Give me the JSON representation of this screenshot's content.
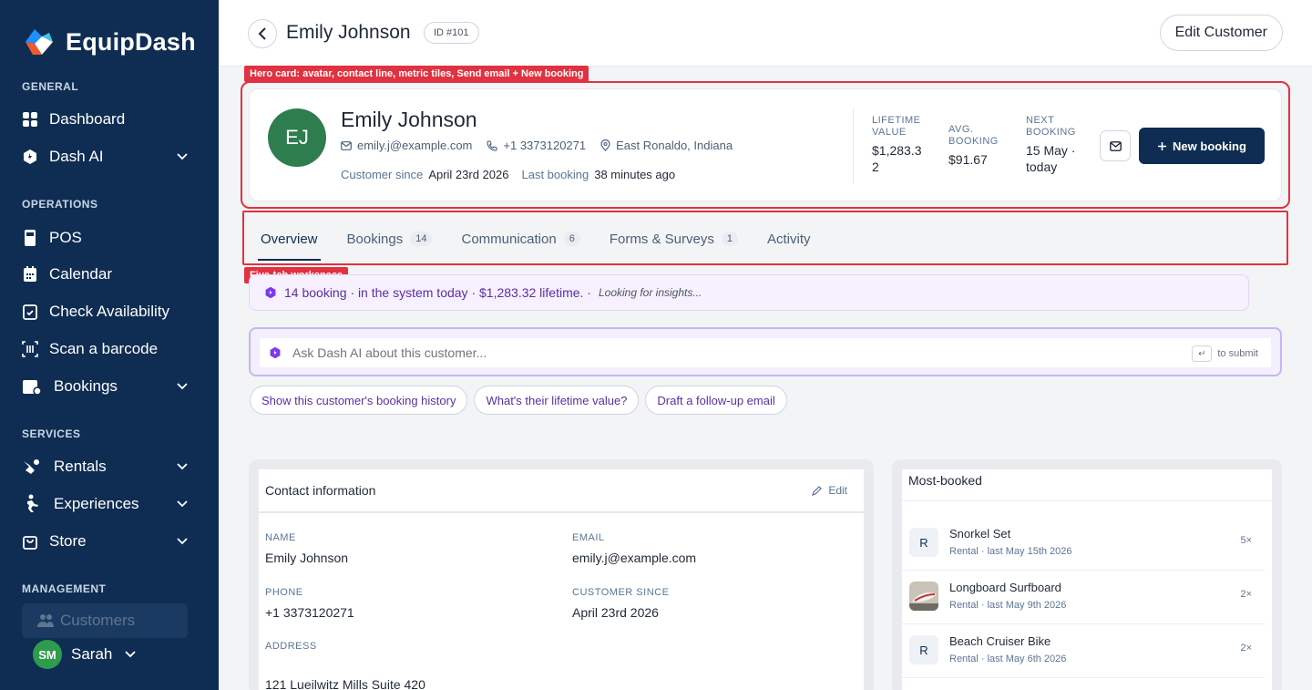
{
  "app": {
    "name": "EquipDash"
  },
  "sidebar": {
    "sections": [
      {
        "label": "GENERAL"
      },
      {
        "label": "OPERATIONS"
      },
      {
        "label": "SERVICES"
      },
      {
        "label": "MANAGEMENT"
      }
    ],
    "items": [
      {
        "label": "Dashboard",
        "icon": "grid-icon"
      },
      {
        "label": "Dash AI",
        "icon": "dash-ai-icon"
      },
      {
        "label": "POS",
        "icon": "pos-icon"
      },
      {
        "label": "Calendar",
        "icon": "calendar-icon"
      },
      {
        "label": "Check Availability",
        "icon": "calendar-check-icon"
      },
      {
        "label": "Scan a barcode",
        "icon": "barcode-icon"
      },
      {
        "label": "Bookings",
        "icon": "bookings-icon"
      },
      {
        "label": "Rentals",
        "icon": "rentals-icon"
      },
      {
        "label": "Experiences",
        "icon": "experiences-icon"
      },
      {
        "label": "Store",
        "icon": "store-icon"
      },
      {
        "label": "Customers",
        "icon": "customers-icon"
      }
    ],
    "user": {
      "initials": "SM",
      "name": "Sarah"
    }
  },
  "topbar": {
    "title": "Emily Johnson",
    "id_badge": "ID #101",
    "edit_label": "Edit Customer"
  },
  "annotations": {
    "hero": "Hero card: avatar, contact line, metric tiles, Send email + New booking",
    "tabs": "Five-tab workspace"
  },
  "hero": {
    "initials": "EJ",
    "name": "Emily Johnson",
    "email": "emily.j@example.com",
    "phone": "+1 3373120271",
    "location": "East Ronaldo, Indiana",
    "since_label": "Customer since",
    "since_value": "April 23rd 2026",
    "last_label": "Last booking",
    "last_value": "38 minutes ago",
    "metrics": [
      {
        "label": "LIFETIME VALUE",
        "value": "$1,283.32"
      },
      {
        "label": "AVG. BOOKING",
        "value": "$91.67"
      },
      {
        "label": "NEXT BOOKING",
        "value": "15 May · today"
      }
    ],
    "new_booking": "New booking"
  },
  "tabs": [
    {
      "label": "Overview",
      "count": ""
    },
    {
      "label": "Bookings",
      "count": "14"
    },
    {
      "label": "Communication",
      "count": "6"
    },
    {
      "label": "Forms & Surveys",
      "count": "1"
    },
    {
      "label": "Activity",
      "count": ""
    }
  ],
  "insight": {
    "text": "14 booking · in the system today · $1,283.32 lifetime. ·",
    "loading": "Looking for insights..."
  },
  "ask": {
    "placeholder": "Ask Dash AI about this customer...",
    "hint": "to submit",
    "key": "↵"
  },
  "chips": [
    "Show this customer's booking history",
    "What's their lifetime value?",
    "Draft a follow-up email"
  ],
  "contact_card": {
    "title": "Contact information",
    "edit": "Edit",
    "fields": [
      {
        "label": "NAME",
        "value": "Emily Johnson"
      },
      {
        "label": "EMAIL",
        "value": "emily.j@example.com"
      },
      {
        "label": "PHONE",
        "value": "+1 3373120271"
      },
      {
        "label": "CUSTOMER SINCE",
        "value": "April 23rd 2026"
      },
      {
        "label": "ADDRESS",
        "value": "121 Lueilwitz Mills Suite 420"
      }
    ]
  },
  "most_booked": {
    "title": "Most-booked",
    "items": [
      {
        "thumb": "R",
        "name": "Snorkel Set",
        "sub": "Rental · last May 15th 2026",
        "count": "5×"
      },
      {
        "thumb": "",
        "name": "Longboard Surfboard",
        "sub": "Rental · last May 9th 2026",
        "count": "2×"
      },
      {
        "thumb": "R",
        "name": "Beach Cruiser Bike",
        "sub": "Rental · last May 6th 2026",
        "count": "2×"
      }
    ]
  }
}
